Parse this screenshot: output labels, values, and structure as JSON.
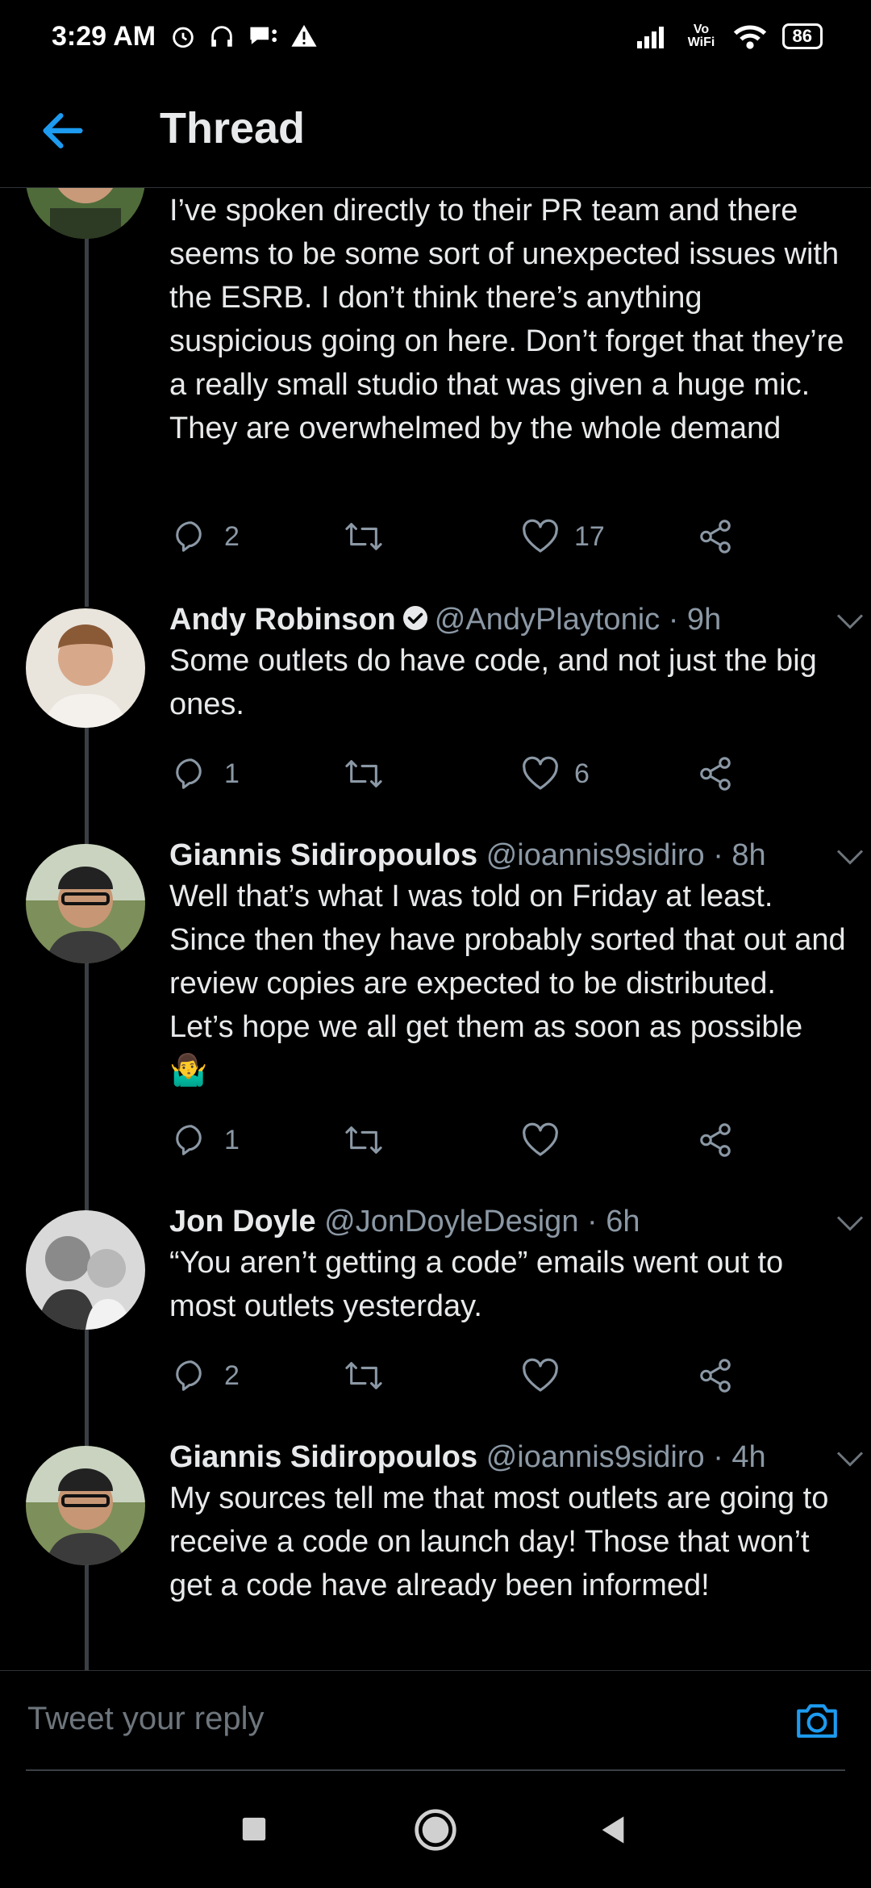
{
  "status_bar": {
    "time": "3:29 AM",
    "battery": "86",
    "wifi_label": "Vo WiFi"
  },
  "header": {
    "title": "Thread"
  },
  "first_post": {
    "text": "I’ve spoken directly to their PR team and there seems to be some sort of unexpected issues with the ESRB. I don’t think there’s anything suspicious going on here. Don’t forget that they’re a really small studio that was given a huge mic. They are overwhelmed by the whole demand",
    "replies": "2",
    "retweets": "",
    "likes": "17"
  },
  "tweets": [
    {
      "name": "Andy Robinson",
      "handle": "@AndyPlaytonic",
      "time": "· 9h",
      "verified": true,
      "text": "Some outlets do have code, and not just the big ones.",
      "replies": "1",
      "retweets": "",
      "likes": "6"
    },
    {
      "name": "Giannis Sidiropoulos",
      "handle": "@ioannis9sidiro",
      "time": "· 8h",
      "verified": false,
      "text": "Well that’s what I was told on Friday at least. Since then they have probably sorted that out and review copies are expected to be distributed. Let’s hope we all get them as soon as possible 🤷‍♂️",
      "replies": "1",
      "retweets": "",
      "likes": ""
    },
    {
      "name": "Jon Doyle",
      "handle": "@JonDoyleDesign",
      "time": "· 6h",
      "verified": false,
      "text": "“You aren’t getting a code” emails went out to most outlets yesterday.",
      "replies": "2",
      "retweets": "",
      "likes": ""
    },
    {
      "name": "Giannis Sidiropoulos",
      "handle": "@ioannis9sidiro",
      "time": "· 4h",
      "verified": false,
      "text": "My sources tell me that most outlets are going to receive a code on launch day! Those that won’t get a code have already been informed!",
      "replies": "",
      "retweets": "",
      "likes": ""
    }
  ],
  "reply_bar": {
    "placeholder": "Tweet your reply"
  },
  "colors": {
    "accent": "#1d9bf0",
    "background": "#000000",
    "secondary_text": "#8b98a5"
  }
}
